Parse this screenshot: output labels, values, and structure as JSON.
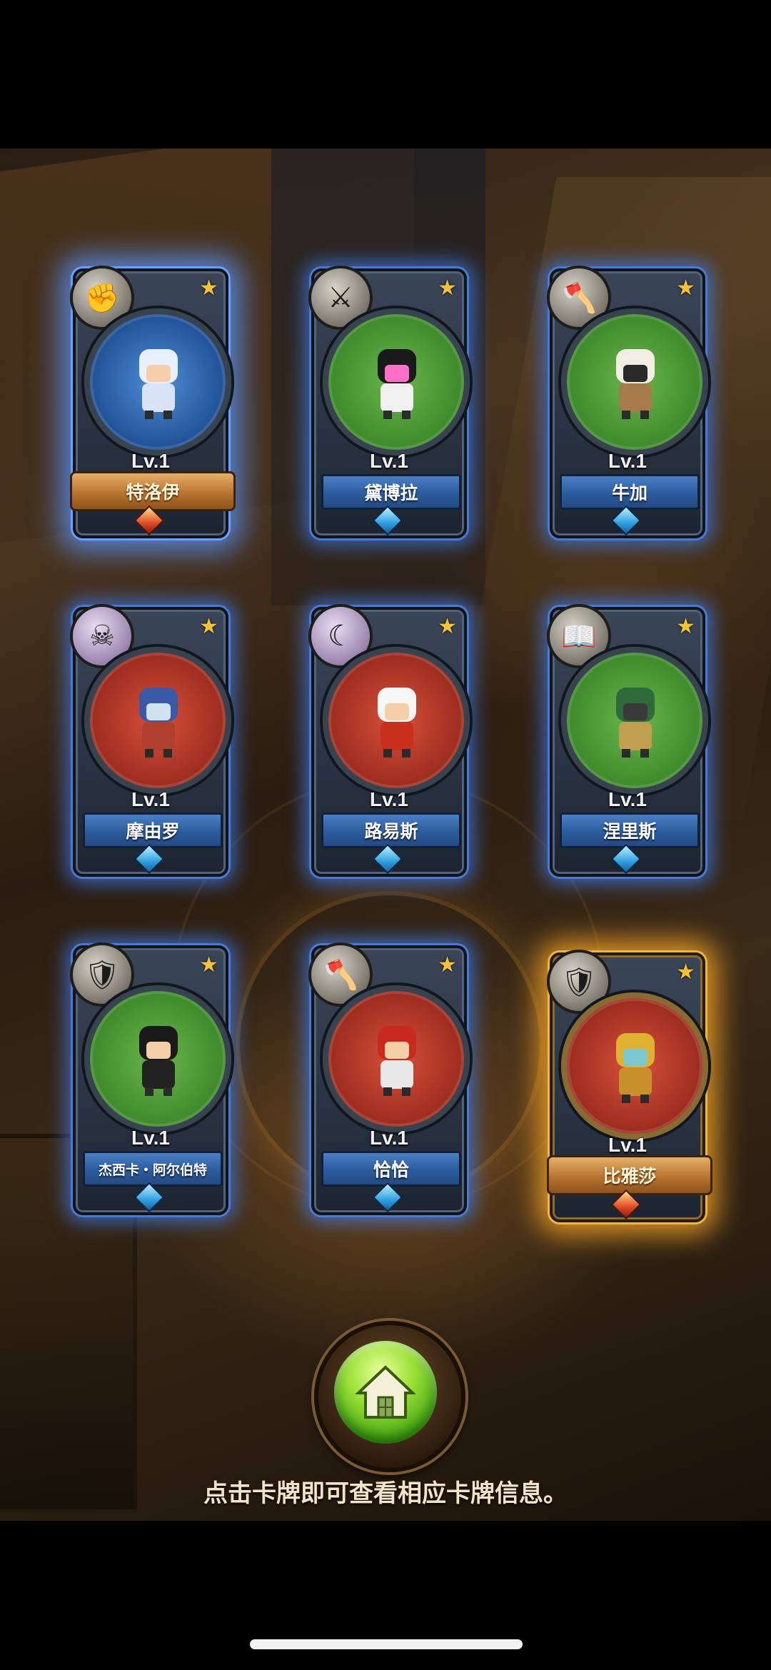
{
  "cards": [
    {
      "level": "Lv.1",
      "name": "特洛伊",
      "class_icon": "fist-icon",
      "style": "legend",
      "portrait": "blue"
    },
    {
      "level": "Lv.1",
      "name": "黛博拉",
      "class_icon": "crossed-swords-icon",
      "style": "normal",
      "portrait": "green"
    },
    {
      "level": "Lv.1",
      "name": "牛加",
      "class_icon": "axe-icon",
      "style": "normal",
      "portrait": "green"
    },
    {
      "level": "Lv.1",
      "name": "摩由罗",
      "class_icon": "skull-icon",
      "style": "normal",
      "portrait": "red"
    },
    {
      "level": "Lv.1",
      "name": "路易斯",
      "class_icon": "moon-icon",
      "style": "normal",
      "portrait": "red"
    },
    {
      "level": "Lv.1",
      "name": "涅里斯",
      "class_icon": "book-icon",
      "style": "normal",
      "portrait": "green"
    },
    {
      "level": "Lv.1",
      "name": "杰西卡・阿尔伯特",
      "class_icon": "wing-shield-icon",
      "style": "normal",
      "portrait": "green"
    },
    {
      "level": "Lv.1",
      "name": "恰恰",
      "class_icon": "axe-icon",
      "style": "normal",
      "portrait": "red"
    },
    {
      "level": "Lv.1",
      "name": "比雅莎",
      "class_icon": "wing-shield-icon",
      "style": "gold",
      "portrait": "red"
    }
  ],
  "hint_text": "点击卡牌即可查看相应卡牌信息。",
  "home_button_icon": "home-icon",
  "colors": {
    "card_glow": "#4a7bd1",
    "gold_glow": "#e8b84a",
    "star": "#f4c23a",
    "home_green": "#4fae16"
  }
}
